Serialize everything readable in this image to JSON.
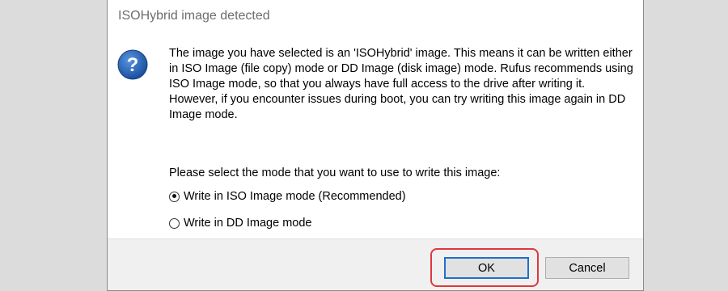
{
  "dialog": {
    "title": "ISOHybrid image detected",
    "icon": "question-icon",
    "paragraphs": [
      "The image you have selected is an 'ISOHybrid' image. This means it can be written either in ISO Image (file copy) mode or DD Image (disk image) mode. Rufus recommends using ISO Image mode, so that you always have full access to the drive after writing it.",
      "However, if you encounter issues during boot, you can try writing this image again in DD Image mode."
    ],
    "prompt": "Please select the mode that you want to use to write this image:",
    "options": [
      {
        "label": "Write in ISO Image mode (Recommended)",
        "selected": true
      },
      {
        "label": "Write in DD Image mode",
        "selected": false
      }
    ],
    "buttons": {
      "ok": "OK",
      "cancel": "Cancel"
    }
  },
  "colors": {
    "icon_blue": "#1d5fb8",
    "highlight_red": "#e0373f",
    "ok_focus_border": "#1f6fcf"
  }
}
